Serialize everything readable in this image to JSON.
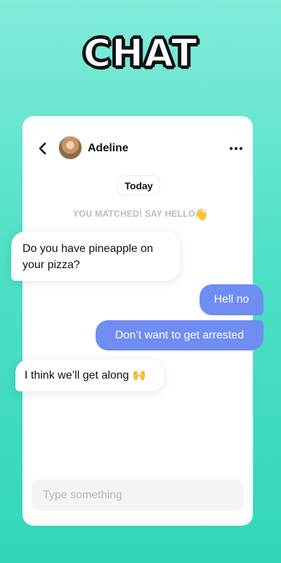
{
  "headline": "CHAT",
  "header": {
    "contact_name": "Adeline"
  },
  "date_label": "Today",
  "match_notice": {
    "text": "YOU MATCHED! SAY HELLO",
    "emoji": "👋"
  },
  "messages": [
    {
      "direction": "in",
      "text": "Do you have pineapple on your pizza?"
    },
    {
      "direction": "out",
      "text": "Hell no"
    },
    {
      "direction": "out",
      "text": "Don’t want to get arrested"
    },
    {
      "direction": "in",
      "text": "I think we’ll get along 🙌"
    }
  ],
  "composer": {
    "placeholder": "Type something",
    "value": ""
  },
  "colors": {
    "background_top": "#82ebd9",
    "background_bottom": "#33d6b9",
    "outgoing_bubble": "#6f8df3",
    "incoming_bubble": "#ffffff",
    "muted_text": "#bdbdbd"
  },
  "icons": {
    "back": "chevron-left-icon",
    "more": "more-horizontal-icon",
    "wave": "waving-hand-icon"
  }
}
